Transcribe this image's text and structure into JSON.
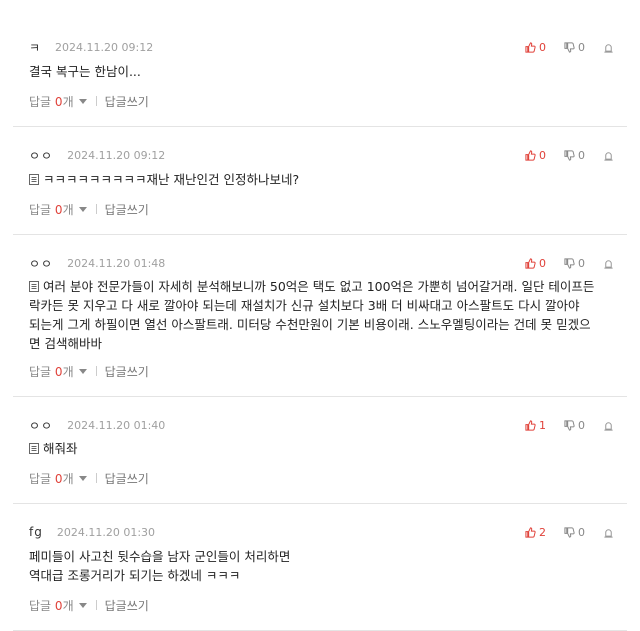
{
  "reply_label": "답글",
  "reply_unit": "개",
  "write_label": "답글쓰기",
  "comments": [
    {
      "nick": "ㅋ",
      "date": "2024.11.20 09:12",
      "likes": "0",
      "dislikes": "0",
      "lines": [
        "결국 복구는 한남이..."
      ]
    },
    {
      "nick": "ㅇㅇ",
      "date": "2024.11.20 09:12",
      "likes": "0",
      "dislikes": "0",
      "lines": [
        "ㅋㅋㅋㅋㅋㅋㅋㅋㅋ재난 재난인건 인정하나보네?"
      ]
    },
    {
      "nick": "ㅇㅇ",
      "date": "2024.11.20 01:48",
      "likes": "0",
      "dislikes": "0",
      "lines": [
        "여러 분야 전문가들이 자세히 분석해보니까 50억은 택도 없고 100억은 가뿐히 넘어갈거래. 일단 테이프든",
        "락카든 못 지우고 다 새로 깔아야 되는데 재설치가 신규 설치보다 3배 더 비싸대고 아스팔트도 다시 깔아야",
        "되는게 그게 하필이면 열선 아스팔트래. 미터당 수천만원이 기본 비용이래. 스노우멜팅이라는 건데 못 믿겠으",
        "면 검색해바바"
      ]
    },
    {
      "nick": "ㅇㅇ",
      "date": "2024.11.20 01:40",
      "likes": "1",
      "dislikes": "0",
      "lines": [
        "해줘좌"
      ]
    },
    {
      "nick": "fg",
      "date": "2024.11.20 01:30",
      "likes": "2",
      "dislikes": "0",
      "lines": [
        "페미들이 사고친 뒷수습을 남자 군인들이 처리하면",
        "역대급 조롱거리가 되기는 하겠네 ㅋㅋㅋ"
      ]
    }
  ],
  "reply_counts": [
    "0",
    "0",
    "0",
    "0",
    "0"
  ]
}
